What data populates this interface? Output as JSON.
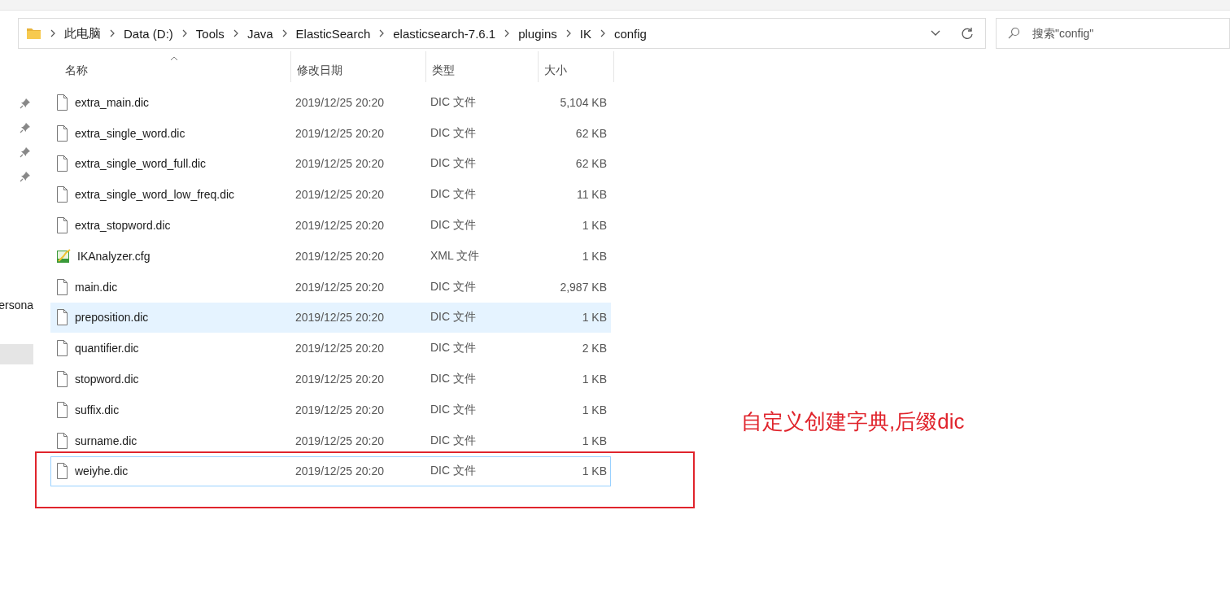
{
  "address_bar": {
    "path": [
      "此电脑",
      "Data (D:)",
      "Tools",
      "Java",
      "ElasticSearch",
      "elasticsearch-7.6.1",
      "plugins",
      "IK",
      "config"
    ]
  },
  "search": {
    "placeholder": "搜索\"config\""
  },
  "sidebar": {
    "items": [
      {
        "label": "ersona",
        "selected": false
      },
      {
        "selected": true
      }
    ]
  },
  "file_list": {
    "columns": [
      {
        "label": "名称",
        "sorted": true
      },
      {
        "label": "修改日期",
        "sorted": false
      },
      {
        "label": "类型",
        "sorted": false
      },
      {
        "label": "大小",
        "sorted": false
      }
    ],
    "rows": [
      {
        "kind": "dic",
        "name": "extra_main.dic",
        "modified": "2019/12/25 20:20",
        "type": "DIC 文件",
        "size": "5,104 KB",
        "hovered": false,
        "focused": false
      },
      {
        "kind": "dic",
        "name": "extra_single_word.dic",
        "modified": "2019/12/25 20:20",
        "type": "DIC 文件",
        "size": "62 KB",
        "hovered": false,
        "focused": false
      },
      {
        "kind": "dic",
        "name": "extra_single_word_full.dic",
        "modified": "2019/12/25 20:20",
        "type": "DIC 文件",
        "size": "62 KB",
        "hovered": false,
        "focused": false
      },
      {
        "kind": "dic",
        "name": "extra_single_word_low_freq.dic",
        "modified": "2019/12/25 20:20",
        "type": "DIC 文件",
        "size": "11 KB",
        "hovered": false,
        "focused": false
      },
      {
        "kind": "dic",
        "name": "extra_stopword.dic",
        "modified": "2019/12/25 20:20",
        "type": "DIC 文件",
        "size": "1 KB",
        "hovered": false,
        "focused": false
      },
      {
        "kind": "cfg",
        "name": "IKAnalyzer.cfg",
        "modified": "2019/12/25 20:20",
        "type": "XML 文件",
        "size": "1 KB",
        "hovered": false,
        "focused": false
      },
      {
        "kind": "dic",
        "name": "main.dic",
        "modified": "2019/12/25 20:20",
        "type": "DIC 文件",
        "size": "2,987 KB",
        "hovered": false,
        "focused": false
      },
      {
        "kind": "dic",
        "name": "preposition.dic",
        "modified": "2019/12/25 20:20",
        "type": "DIC 文件",
        "size": "1 KB",
        "hovered": true,
        "focused": false
      },
      {
        "kind": "dic",
        "name": "quantifier.dic",
        "modified": "2019/12/25 20:20",
        "type": "DIC 文件",
        "size": "2 KB",
        "hovered": false,
        "focused": false
      },
      {
        "kind": "dic",
        "name": "stopword.dic",
        "modified": "2019/12/25 20:20",
        "type": "DIC 文件",
        "size": "1 KB",
        "hovered": false,
        "focused": false
      },
      {
        "kind": "dic",
        "name": "suffix.dic",
        "modified": "2019/12/25 20:20",
        "type": "DIC 文件",
        "size": "1 KB",
        "hovered": false,
        "focused": false
      },
      {
        "kind": "dic",
        "name": "surname.dic",
        "modified": "2019/12/25 20:20",
        "type": "DIC 文件",
        "size": "1 KB",
        "hovered": false,
        "focused": false
      },
      {
        "kind": "dic",
        "name": "weiyhe.dic",
        "modified": "2019/12/25 20:20",
        "type": "DIC 文件",
        "size": "1 KB",
        "hovered": false,
        "focused": true
      }
    ]
  },
  "annotation": {
    "text": "自定义创建字典,后缀dic"
  }
}
